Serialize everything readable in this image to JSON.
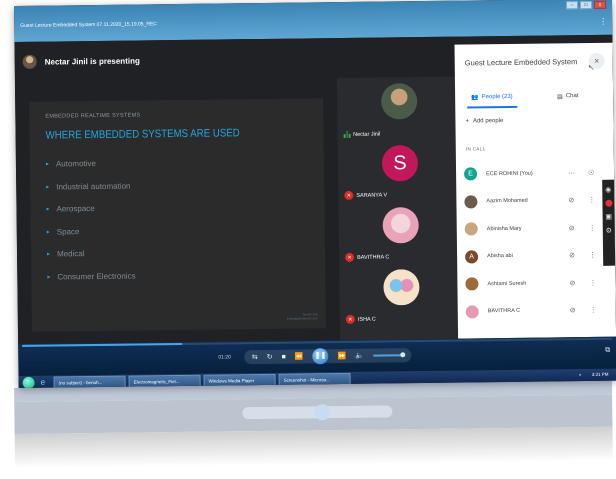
{
  "window": {
    "title": "Guest Lecture Embedded System 07.11.2020_15.19.05_REC",
    "minimize": "–",
    "maximize": "□",
    "close": "x",
    "more": "⋮"
  },
  "meet": {
    "presenter_text": "Nectar Jinil is presenting",
    "slide": {
      "kicker": "EMBEDDED REALTIME SYSTEMS",
      "title": "WHERE EMBEDDED SYSTEMS ARE USED",
      "bullets": [
        "Automotive",
        "Industrial automation",
        "Aerospace",
        "Space",
        "Medical",
        "Consumer Electronics"
      ],
      "footer_line1": "Nectar Jinil",
      "footer_line2": "Embedded Mentor.com"
    },
    "tiles": [
      {
        "name": "Nectar Jinil",
        "mic": "on"
      },
      {
        "name": "SARANYA V",
        "mic": "off",
        "initial": "S"
      },
      {
        "name": "BAVITHRA C",
        "mic": "off"
      },
      {
        "name": "ISHA C",
        "mic": "off"
      }
    ]
  },
  "panel": {
    "title": "Guest Lecture Embedded System",
    "close_icon": "×",
    "people_tab": "People (23)",
    "chat_tab": "Chat",
    "add_people": "Add people",
    "in_call": "IN CALL",
    "participants": [
      {
        "name": "ECE ROHINI (You)",
        "initial": "E",
        "color": "#12a48f"
      },
      {
        "name": "Aazim Mohamed",
        "color": "#6b5b4e"
      },
      {
        "name": "Abinisha Mary",
        "color": "#c7a77d"
      },
      {
        "name": "Abisha abi",
        "initial": "A",
        "color": "#7a4a2a"
      },
      {
        "name": "Ashtami Suresh",
        "color": "#9b6b3b"
      },
      {
        "name": "BAVITHRA C",
        "color": "#e59ab2"
      }
    ]
  },
  "player": {
    "time": "01:20"
  },
  "taskbar": {
    "items": [
      "(no subject) - benuh...",
      "Electromagnetic_Fiel...",
      "Windows Media Player",
      "Screenshot - Microso..."
    ],
    "clock": "3:31 PM"
  },
  "colors": {
    "accent": "#1a73e8",
    "slide_title": "#23a6e0",
    "mic_off": "#d93025",
    "mic_on": "#34a853"
  }
}
